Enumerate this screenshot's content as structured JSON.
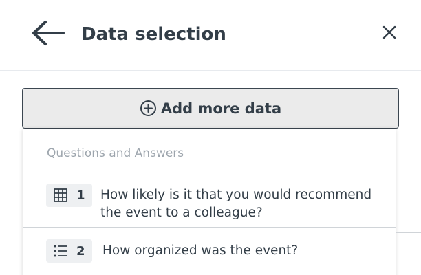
{
  "header": {
    "title": "Data selection",
    "back_icon": "arrow-left-icon",
    "close_icon": "close-icon"
  },
  "add_data": {
    "label": "Add more data",
    "icon": "plus-circle-icon"
  },
  "dropdown": {
    "section_title": "Questions and Answers",
    "questions": [
      {
        "number": "1",
        "icon": "grid-icon",
        "text": "How likely is it that you would recommend the event to a colleague?"
      },
      {
        "number": "2",
        "icon": "list-icon",
        "text": "How organized was the event?"
      }
    ]
  },
  "colors": {
    "text": "#333e48",
    "muted": "#9da5ad",
    "button_bg": "#ebebeb",
    "button_border": "#3b4650",
    "badge_bg": "#eef0f2",
    "divider": "#d0d4d8"
  }
}
